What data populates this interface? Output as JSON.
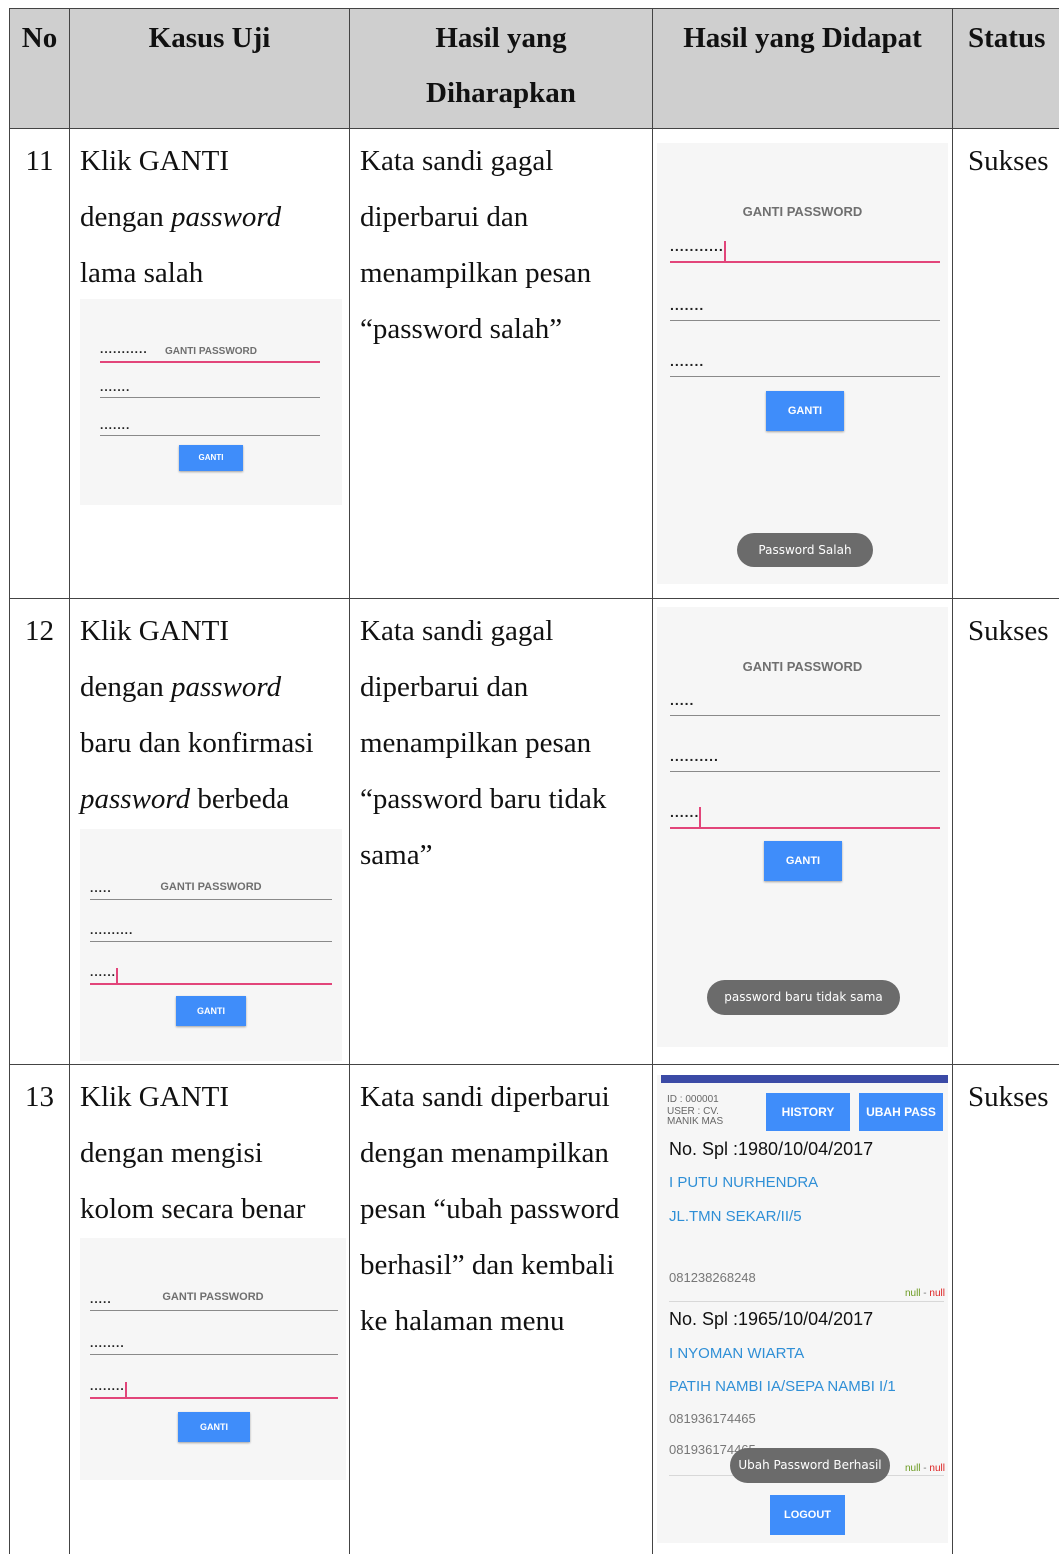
{
  "headers": {
    "no": "No",
    "case": "Kasus Uji",
    "expected_l1": "Hasil yang",
    "expected_l2": "Diharapkan",
    "actual": "Hasil yang Didapat",
    "status": "Status"
  },
  "rows": [
    {
      "no": "11",
      "case_l1": "Klik GANTI",
      "case_l2a": "dengan ",
      "case_l2b": "password",
      "case_l3": "lama salah",
      "exp_l1": "Kata sandi gagal",
      "exp_l2": "diperbarui dan",
      "exp_l3": "menampilkan pesan",
      "exp_l4": "“password salah”",
      "status": "Sukses",
      "shot_small": {
        "title": "GANTI PASSWORD",
        "f1": "...........",
        "f2": ".......",
        "f3": ".......",
        "button": "GANTI"
      },
      "shot_big": {
        "title": "GANTI PASSWORD",
        "f1": "...........",
        "f2": ".......",
        "f3": ".......",
        "button": "GANTI",
        "toast": "Password Salah"
      }
    },
    {
      "no": "12",
      "case_l1": "Klik GANTI",
      "case_l2a": "dengan ",
      "case_l2b": "password",
      "case_l3": "baru dan konfirmasi",
      "case_l4a": "password",
      "case_l4b": " berbeda",
      "exp_l1": "Kata sandi gagal",
      "exp_l2": "diperbarui dan",
      "exp_l3": "menampilkan pesan",
      "exp_l4": "“password baru tidak",
      "exp_l5": "sama”",
      "status": "Sukses",
      "shot_small": {
        "title": "GANTI PASSWORD",
        "f1": ".....",
        "f2": "..........",
        "f3": "......",
        "button": "GANTI"
      },
      "shot_big": {
        "title": "GANTI PASSWORD",
        "f1": ".....",
        "f2": "..........",
        "f3": "......",
        "button": "GANTI",
        "toast": "password baru tidak sama"
      }
    },
    {
      "no": "13",
      "case_l1": "Klik GANTI",
      "case_l2": "dengan mengisi",
      "case_l3": "kolom secara benar",
      "exp_l1": "Kata sandi diperbarui",
      "exp_l2": "dengan menampilkan",
      "exp_l3": "pesan “ubah password",
      "exp_l4": "berhasil” dan kembali",
      "exp_l5": "ke halaman menu",
      "status": "Sukses",
      "shot_small": {
        "title": "GANTI PASSWORD",
        "f1": ".....",
        "f2": "........",
        "f3": "........",
        "button": "GANTI"
      },
      "menu": {
        "id": "ID : 000001",
        "user1": "USER : CV.",
        "user2": "MANIK MAS",
        "history": "HISTORY",
        "ubah": "UBAH PASS",
        "e1": {
          "spl": "No. Spl :1980/10/04/2017",
          "name": "I PUTU NURHENDRA",
          "addr": "JL.TMN SEKAR/II/5",
          "phone": "081238268248",
          "null1": "null",
          "dash": " - ",
          "null2": "null"
        },
        "e2": {
          "spl": "No. Spl :1965/10/04/2017",
          "name": "I NYOMAN WIARTA",
          "addr": "PATIH NAMBI IA/SEPA NAMBI I/1",
          "phone1": "081936174465",
          "phone2": "081936174465",
          "null1": "null",
          "dash": " - ",
          "null2": "null"
        },
        "toast": "Ubah Password Berhasil",
        "logout": "LOGOUT"
      }
    }
  ]
}
